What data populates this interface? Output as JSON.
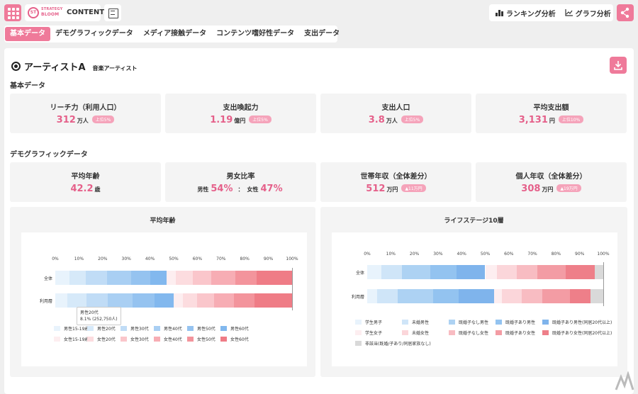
{
  "brand": {
    "logo_mark": "ST",
    "logo_line1": "STRATEGY",
    "logo_line2": "BLOOM",
    "logo_suffix": "CONTENT"
  },
  "header": {
    "ranking_label": "ランキング分析",
    "graph_label": "グラフ分析"
  },
  "tabs": [
    {
      "label": "基本データ",
      "active": true
    },
    {
      "label": "デモグラフィックデータ"
    },
    {
      "label": "メディア接触データ"
    },
    {
      "label": "コンテンツ嗜好性データ"
    },
    {
      "label": "支出データ"
    }
  ],
  "artist": {
    "name": "アーティストA",
    "type": "音楽アーティスト"
  },
  "basic": {
    "title": "基本データ",
    "cards": [
      {
        "title": "リーチ力（利用人口）",
        "value": "312",
        "unit": "万人",
        "badge": "上位5%"
      },
      {
        "title": "支出喚起力",
        "value": "1.19",
        "unit": "億円",
        "badge": "上位5%"
      },
      {
        "title": "支出人口",
        "value": "3.8",
        "unit": "万人",
        "badge": "上位5%"
      },
      {
        "title": "平均支出額",
        "value": "3,131",
        "unit": "円",
        "badge": "上位10%"
      }
    ]
  },
  "demo": {
    "title": "デモグラフィックデータ",
    "age": {
      "title": "平均年齢",
      "value": "42.2",
      "unit": "歳"
    },
    "gender": {
      "title": "男女比率",
      "male_label": "男性",
      "male_value": "54%",
      "female_label": "女性",
      "female_value": "47%"
    },
    "household": {
      "title": "世帯年収（全体差分）",
      "value": "512",
      "unit": "万円",
      "badge": "▲11万円"
    },
    "personal": {
      "title": "個人年収（全体差分）",
      "value": "308",
      "unit": "万円",
      "badge": "▲19万円"
    }
  },
  "charts": {
    "left": {
      "title": "平均年齢",
      "ticks": [
        "0%",
        "10%",
        "20%",
        "30%",
        "40%",
        "50%",
        "60%",
        "70%",
        "80%",
        "90%",
        "100%"
      ],
      "rows": [
        "全体",
        "利用層"
      ],
      "legend": [
        "男性15-19歳",
        "男性20代",
        "男性30代",
        "男性40代",
        "男性50代",
        "男性60代",
        "女性15-19歳",
        "女性20代",
        "女性30代",
        "女性40代",
        "女性50代",
        "女性60代"
      ],
      "colors": [
        "#e8f3fc",
        "#d6e9f9",
        "#c0dcf6",
        "#a9cff3",
        "#95c3f0",
        "#82b8ee",
        "#fdeef0",
        "#fcdcdf",
        "#fac6cb",
        "#f7adb4",
        "#f3949c",
        "#ef7c86"
      ],
      "tooltip": {
        "line1": "男性20代",
        "line2": "8.1% (252,750人)"
      }
    },
    "right": {
      "title": "ライフステージ10層",
      "ticks": [
        "0%",
        "10%",
        "20%",
        "30%",
        "40%",
        "50%",
        "60%",
        "70%",
        "80%",
        "90%",
        "100%"
      ],
      "rows": [
        "全体",
        "利用層"
      ],
      "legend": [
        "学生男子",
        "未婚男性",
        "既婚子なし男性",
        "既婚子あり男性",
        "既婚子あり男性(同居20代以上)",
        "学生女子",
        "未婚女性",
        "既婚子なし女性",
        "既婚子あり女性",
        "既婚子あり女性(同居20代以上)",
        "非該当(既婚/子あり/同居家族なし)"
      ],
      "colors": [
        "#e8f3fc",
        "#cfe5f8",
        "#add2f3",
        "#93c3f0",
        "#7fb4ec",
        "#fdeef0",
        "#fbd6da",
        "#f8bcc2",
        "#f39ca4",
        "#ee7f89",
        "#d9d9d9"
      ]
    }
  },
  "chart_data": [
    {
      "type": "bar",
      "title": "平均年齢",
      "orientation": "horizontal-stacked-percent",
      "categories": [
        "全体",
        "利用層"
      ],
      "xlim": [
        0,
        100
      ],
      "series": [
        {
          "name": "男性15-19歳",
          "values": [
            6,
            5
          ]
        },
        {
          "name": "男性20代",
          "values": [
            7,
            8.1
          ]
        },
        {
          "name": "男性30代",
          "values": [
            9,
            9
          ]
        },
        {
          "name": "男性40代",
          "values": [
            10,
            10.6
          ]
        },
        {
          "name": "男性50代",
          "values": [
            8,
            9.3
          ]
        },
        {
          "name": "男性60代",
          "values": [
            7,
            8
          ]
        },
        {
          "name": "女性15-19歳",
          "values": [
            4,
            4
          ]
        },
        {
          "name": "女性20代",
          "values": [
            7,
            6
          ]
        },
        {
          "name": "女性30代",
          "values": [
            8,
            7
          ]
        },
        {
          "name": "女性40代",
          "values": [
            10,
            8.5
          ]
        },
        {
          "name": "女性50代",
          "values": [
            9,
            8.5
          ]
        },
        {
          "name": "女性60代",
          "values": [
            15,
            16
          ]
        }
      ]
    },
    {
      "type": "bar",
      "title": "ライフステージ10層",
      "orientation": "horizontal-stacked-percent",
      "categories": [
        "全体",
        "利用層"
      ],
      "xlim": [
        0,
        100
      ],
      "series": [
        {
          "name": "学生男子",
          "values": [
            5,
            4
          ]
        },
        {
          "name": "未婚男性",
          "values": [
            7,
            8
          ]
        },
        {
          "name": "既婚子なし男性",
          "values": [
            10,
            14
          ]
        },
        {
          "name": "既婚子あり男性",
          "values": [
            9,
            10
          ]
        },
        {
          "name": "既婚子あり男性(同居20代以上)",
          "values": [
            10,
            14
          ]
        },
        {
          "name": "学生女子",
          "values": [
            4,
            3
          ]
        },
        {
          "name": "未婚女性",
          "values": [
            7,
            8
          ]
        },
        {
          "name": "既婚子なし女性",
          "values": [
            7,
            8
          ]
        },
        {
          "name": "既婚子あり女性",
          "values": [
            10,
            11
          ]
        },
        {
          "name": "既婚子あり女性(同居20代以上)",
          "values": [
            10,
            8
          ]
        },
        {
          "name": "非該当(既婚/子あり/同居家族なし)",
          "values": [
            3,
            5
          ]
        }
      ]
    }
  ]
}
